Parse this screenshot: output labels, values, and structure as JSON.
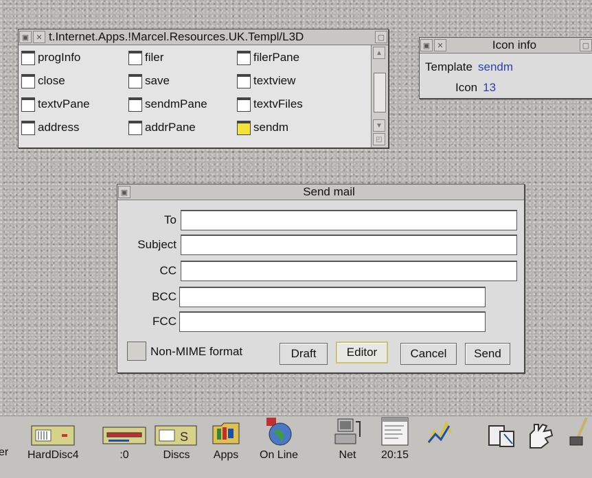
{
  "template_window": {
    "title": "t.Internet.Apps.!Marcel.Resources.UK.Templ/L3D",
    "items": [
      {
        "label": "progInfo"
      },
      {
        "label": "filer"
      },
      {
        "label": "filerPane"
      },
      {
        "label": "close"
      },
      {
        "label": "save"
      },
      {
        "label": "textview"
      },
      {
        "label": "textvPane"
      },
      {
        "label": "sendmPane"
      },
      {
        "label": "textvFiles"
      },
      {
        "label": "address"
      },
      {
        "label": "addrPane"
      },
      {
        "label": "sendm"
      }
    ],
    "selected": "sendm"
  },
  "icon_info": {
    "title": "Icon info",
    "template_label": "Template",
    "template_value": "sendm",
    "icon_label": "Icon",
    "icon_value": "13"
  },
  "send_mail": {
    "title": "Send mail",
    "fields": {
      "to_label": "To",
      "to_value": "",
      "subject_label": "Subject",
      "subject_value": "",
      "cc_label": "CC",
      "cc_value": "",
      "bcc_label": "BCC",
      "bcc_value": "",
      "fcc_label": "FCC",
      "fcc_value": ""
    },
    "non_mime_label": "Non-MIME format",
    "buttons": {
      "draft": "Draft",
      "editor": "Editor",
      "cancel": "Cancel",
      "send": "Send"
    }
  },
  "iconbar": {
    "items": [
      {
        "label": "er",
        "icon": "filer-icon"
      },
      {
        "label": "HardDisc4",
        "icon": "harddisc-icon"
      },
      {
        "label": ":0",
        "icon": "floppy-icon"
      },
      {
        "label": "Discs",
        "icon": "discs-icon"
      },
      {
        "label": "Apps",
        "icon": "apps-folder-icon"
      },
      {
        "label": "On Line",
        "icon": "globe-icon"
      },
      {
        "label": "Net",
        "icon": "network-icon"
      },
      {
        "label": "20:15",
        "icon": "clock-menu-icon"
      },
      {
        "label": "",
        "icon": "chart-icon"
      },
      {
        "label": "",
        "icon": "film-icon"
      },
      {
        "label": "",
        "icon": "hand-icon"
      },
      {
        "label": "",
        "icon": "pen-icon"
      }
    ]
  },
  "colors": {
    "accent_blue": "#2a3fb5",
    "selected_yellow": "#f2e23a"
  }
}
